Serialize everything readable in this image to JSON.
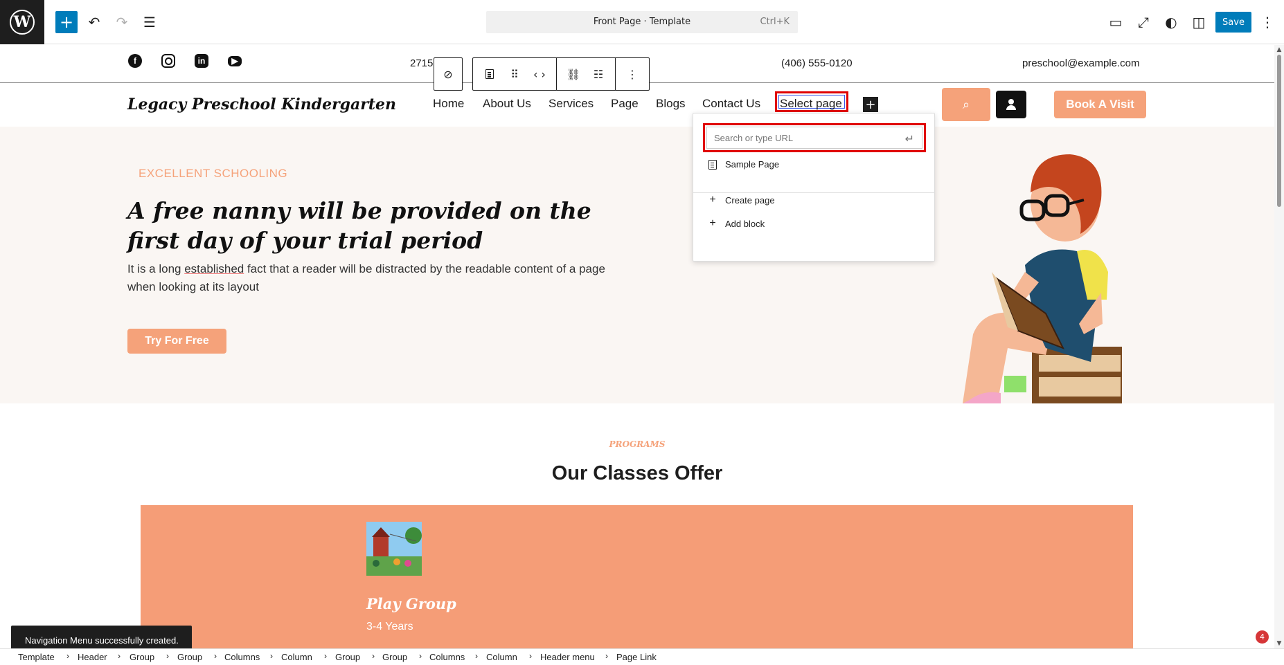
{
  "editor": {
    "wp_logo": "W",
    "document_title": "Front Page · Template",
    "shortcut": "Ctrl+K",
    "save_label": "Save",
    "icons": [
      "add-block-icon",
      "undo-icon",
      "redo-icon",
      "document-overview-icon",
      "view-icon",
      "fullscreen-icon",
      "styles-icon",
      "settings-icon",
      "options-icon"
    ]
  },
  "topinfo": {
    "address": "2715",
    "phone": "(406) 555-0120",
    "email": "preschool@example.com",
    "social": [
      "facebook-icon",
      "instagram-icon",
      "linkedin-icon",
      "youtube-icon"
    ]
  },
  "header": {
    "site_title": "Legacy Preschool Kindergarten",
    "nav": [
      "Home",
      "About Us",
      "Services",
      "Page",
      "Blogs",
      "Contact Us"
    ],
    "select_page": "Select page",
    "book_visit": "Book A Visit"
  },
  "link_popover": {
    "search_placeholder": "Search or type URL",
    "results": [
      "Sample Page"
    ],
    "create_page": "Create page",
    "add_block": "Add block"
  },
  "hero": {
    "eyebrow": "EXCELLENT SCHOOLING",
    "title": "A free nanny will be provided on the first day of your trial period",
    "text_before": "It is a long ",
    "text_underlined": "established",
    "text_after": " fact that a reader will be distracted by the readable content of a page when looking at its layout",
    "cta": "Try For Free"
  },
  "programs": {
    "eyebrow": "PROGRAMS",
    "title": "Our Classes Offer",
    "classes": [
      {
        "name": "Play Group",
        "age": "3-4 Years"
      }
    ]
  },
  "notice": "Navigation Menu successfully created.",
  "notification_count": "4",
  "breadcrumbs": [
    "Template",
    "Header",
    "Group",
    "Group",
    "Columns",
    "Column",
    "Group",
    "Group",
    "Columns",
    "Column",
    "Header menu",
    "Page Link"
  ]
}
